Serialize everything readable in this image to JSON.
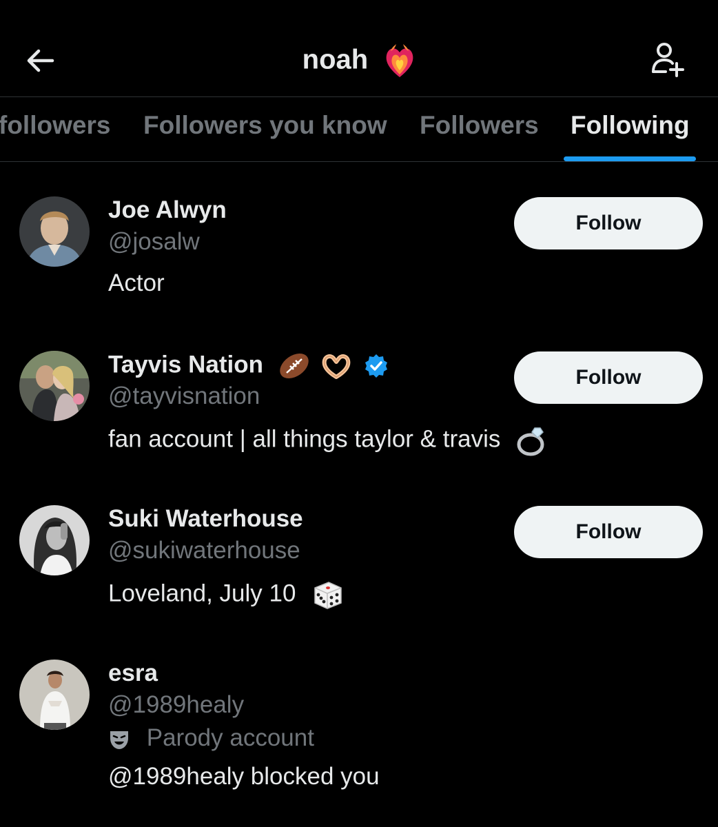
{
  "header": {
    "title": "noah",
    "title_emoji": "heart-on-fire-icon"
  },
  "tabs": [
    {
      "label": "followers",
      "active": false
    },
    {
      "label": "Followers you know",
      "active": false
    },
    {
      "label": "Followers",
      "active": false
    },
    {
      "label": "Following",
      "active": true
    }
  ],
  "users": [
    {
      "name": "Joe Alwyn",
      "handle": "@josalw",
      "bio": "Actor",
      "button": "Follow"
    },
    {
      "name": "Tayvis Nation",
      "name_icons": [
        "football-icon",
        "heart-hands-icon",
        "verified-badge-icon"
      ],
      "handle": "@tayvisnation",
      "bio": "fan account | all things taylor & travis",
      "bio_icon": "ring-icon",
      "button": "Follow"
    },
    {
      "name": "Suki Waterhouse",
      "handle": "@sukiwaterhouse",
      "bio": "Loveland, July 10",
      "bio_icon": "dice-icon",
      "button": "Follow"
    },
    {
      "name": "esra",
      "handle": "@1989healy",
      "parody_label": "Parody account",
      "bio": "@1989healy blocked you"
    }
  ],
  "colors": {
    "background": "#000000",
    "text_primary": "#e7e9ea",
    "text_secondary": "#71767b",
    "accent": "#1d9bf0",
    "button_bg": "#eff3f4",
    "divider": "#2f3336"
  }
}
